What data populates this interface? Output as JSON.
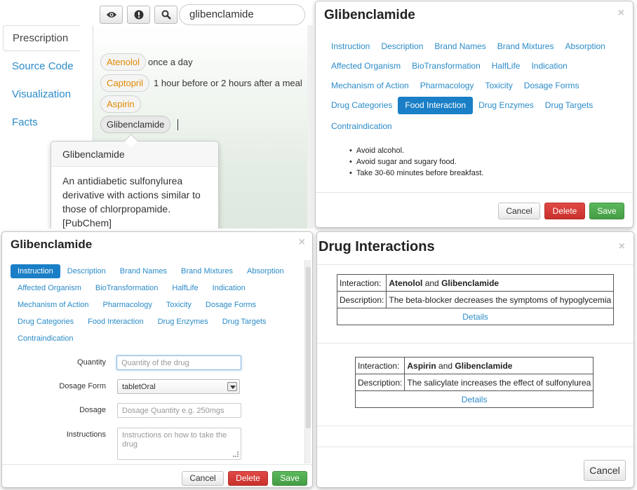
{
  "prescription": {
    "search": {
      "value": "glibenclamide"
    },
    "toolbar": {
      "eye_icon": "eye-icon",
      "alert_icon": "exclamation-icon",
      "search_icon": "search-icon"
    },
    "tabs": [
      "Prescription",
      "Source Code",
      "Visualization",
      "Facts"
    ],
    "drugs": [
      {
        "name": "Atenolol",
        "note": "once a day"
      },
      {
        "name": "Captopril",
        "note": "1 hour before or 2 hours after a meal"
      },
      {
        "name": "Aspirin",
        "note": ""
      },
      {
        "name": "Glibenclamide",
        "note": ""
      }
    ],
    "popover": {
      "title": "Glibenclamide",
      "body": "An antidiabetic sulfonylurea derivative with actions similar to those of chlorpropamide. [PubChem]"
    }
  },
  "food_modal": {
    "title": "Glibenclamide",
    "close": "×",
    "tabs": [
      "Instruction",
      "Description",
      "Brand Names",
      "Brand Mixtures",
      "Absorption",
      "Affected Organism",
      "BioTransformation",
      "HalfLife",
      "Indication",
      "Mechanism of Action",
      "Pharmacology",
      "Toxicity",
      "Dosage Forms",
      "Drug Categories",
      "Food Interaction",
      "Drug Enzymes",
      "Drug Targets",
      "Contraindication"
    ],
    "active_tab": "Food Interaction",
    "items": [
      "Avoid alcohol.",
      "Avoid sugar and sugary food.",
      "Take 30-60 minutes before breakfast."
    ],
    "buttons": {
      "cancel": "Cancel",
      "delete": "Delete",
      "save": "Save"
    }
  },
  "instruction_modal": {
    "title": "Glibenclamide",
    "close": "×",
    "tabs": [
      "Instruction",
      "Description",
      "Brand Names",
      "Brand Mixtures",
      "Absorption",
      "Affected Organism",
      "BioTransformation",
      "HalfLife",
      "Indication",
      "Mechanism of Action",
      "Pharmacology",
      "Toxicity",
      "Dosage Forms",
      "Drug Categories",
      "Food Interaction",
      "Drug Enzymes",
      "Drug Targets",
      "Contraindication"
    ],
    "active_tab": "Instruction",
    "form": {
      "quantity_label": "Quantity",
      "quantity_placeholder": "Quantity of the drug",
      "dosage_form_label": "Dosage Form",
      "dosage_form_value": "tabletOral",
      "dosage_label": "Dosage",
      "dosage_placeholder": "Dosage Quantity e.g. 250mgs",
      "instructions_label": "Instructions",
      "instructions_placeholder": "Instructions on how to take the drug"
    },
    "buttons": {
      "cancel": "Cancel",
      "delete": "Delete",
      "save": "Save"
    }
  },
  "interactions_modal": {
    "title": "Drug Interactions",
    "close": "×",
    "interaction_label": "Interaction:",
    "description_label": "Description:",
    "and": "and",
    "details": "Details",
    "items": [
      {
        "drug_a": "Atenolol",
        "drug_b": "Glibenclamide",
        "description": "The beta-blocker decreases the symptoms of hypoglycemia"
      },
      {
        "drug_a": "Aspirin",
        "drug_b": "Glibenclamide",
        "description": "The salicylate increases the effect of sulfonylurea"
      }
    ],
    "buttons": {
      "cancel": "Cancel"
    }
  },
  "colors": {
    "accent": "#1a7fc6",
    "link": "#2a8bc8",
    "pill_text": "#e08a00",
    "danger": "#d9534f",
    "success": "#5cb85c"
  }
}
